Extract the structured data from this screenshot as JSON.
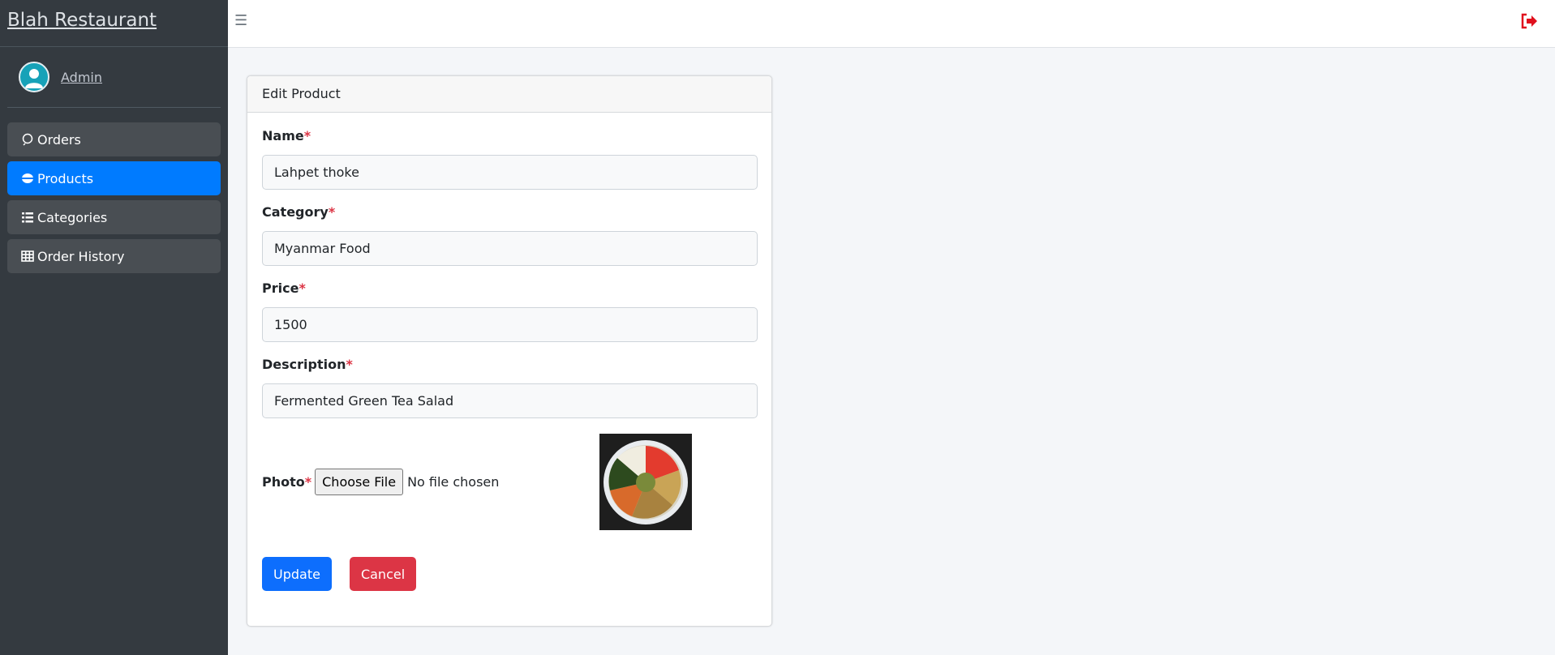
{
  "brand": {
    "title": "Blah Restaurant"
  },
  "user": {
    "name": "Admin"
  },
  "sidebar": {
    "items": [
      {
        "label": "Orders",
        "icon": "orders-icon",
        "active": false
      },
      {
        "label": "Products",
        "icon": "products-icon",
        "active": true
      },
      {
        "label": "Categories",
        "icon": "list-icon",
        "active": false
      },
      {
        "label": "Order History",
        "icon": "table-icon",
        "active": false
      }
    ]
  },
  "topbar": {
    "menu_icon": "hamburger-icon",
    "logout_icon": "logout-icon"
  },
  "form": {
    "title": "Edit Product",
    "name": {
      "label": "Name",
      "value": "Lahpet thoke"
    },
    "category": {
      "label": "Category",
      "value": "Myanmar Food"
    },
    "price": {
      "label": "Price",
      "value": "1500"
    },
    "description": {
      "label": "Description",
      "value": "Fermented Green Tea Salad"
    },
    "photo": {
      "label": "Photo",
      "button": "Choose File",
      "status": "No file chosen"
    },
    "required_mark": "*",
    "update_label": "Update",
    "cancel_label": "Cancel"
  },
  "colors": {
    "sidebar": "#343a40",
    "active": "#007bff",
    "primary": "#0d6efd",
    "danger": "#dc3545"
  }
}
